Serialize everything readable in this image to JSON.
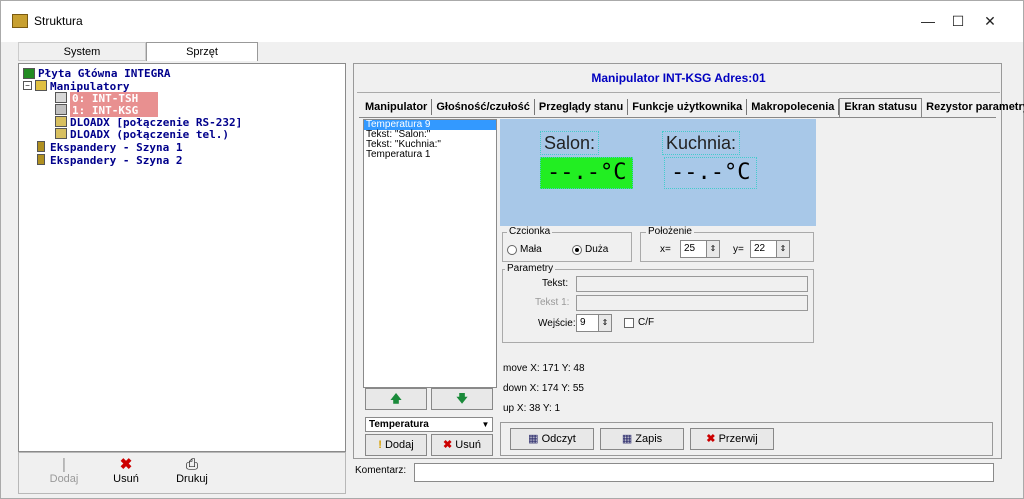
{
  "window": {
    "title": "Struktura",
    "controls": {
      "minimize": "—",
      "maximize": "☐",
      "close": "✕"
    }
  },
  "top_tabs": [
    "System",
    "Sprzęt"
  ],
  "tree": {
    "nodes": [
      {
        "label": "Płyta Główna INTEGRA",
        "icon": "board-icon"
      },
      {
        "label": "Manipulatory",
        "icon": "keypad-group-icon"
      },
      {
        "label": "0: INT-TSH",
        "icon": "keypad-icon",
        "selected": true
      },
      {
        "label": "1: INT-KSG",
        "icon": "keypad-icon",
        "selected": true
      },
      {
        "label": "DLOADX [połączenie RS-232]",
        "icon": "computer-icon"
      },
      {
        "label": "DLOADX (połączenie tel.)",
        "icon": "computer-icon"
      },
      {
        "label": "Ekspandery - Szyna 1",
        "icon": "expander-icon"
      },
      {
        "label": "Ekspandery - Szyna 2",
        "icon": "expander-icon"
      }
    ]
  },
  "left_buttons": {
    "add": "Dodaj",
    "delete": "Usuń",
    "print": "Drukuj"
  },
  "header": "Manipulator INT-KSG Adres:01",
  "tabs": [
    "Manipulator",
    "Głośność/czułość",
    "Przeglądy stanu",
    "Funkcje użytkownika",
    "Makropolecenia",
    "Ekran statusu",
    "Rezystor parametryczny"
  ],
  "active_tab": "Ekran statusu",
  "element_list": [
    "Temperatura 9",
    "Tekst: \"Salon:\"",
    "Tekst: \"Kuchnia:\"",
    "Temperatura 1"
  ],
  "element_type": "Temperatura",
  "list_buttons": {
    "add": "Dodaj",
    "delete": "Usuń"
  },
  "preview": {
    "label1": "Salon:",
    "label2": "Kuchnia:",
    "value1": "--.-°C",
    "value2": "--.-°C"
  },
  "font_group": {
    "title": "Czcionka",
    "small": "Mała",
    "large": "Duża",
    "selected": "Duża"
  },
  "position_group": {
    "title": "Położenie",
    "x_label": "x=",
    "x_value": "25",
    "y_label": "y=",
    "y_value": "22"
  },
  "params_group": {
    "title": "Parametry",
    "text_label": "Tekst:",
    "text1_label": "Tekst 1:",
    "input_label": "Wejście:",
    "input_value": "9",
    "cf_label": "C/F"
  },
  "debug": {
    "move": "move X: 171 Y: 48",
    "down": "down X: 174 Y: 55",
    "up": "up  X: 38 Y: 1"
  },
  "actions": {
    "read": "Odczyt",
    "write": "Zapis",
    "interrupt": "Przerwij"
  },
  "comment_label": "Komentarz:",
  "colors": {
    "preview_bg": "#a8c8e8",
    "green_value": "#22ee22",
    "header_text": "#0000c0",
    "tree_text": "#00008b"
  }
}
